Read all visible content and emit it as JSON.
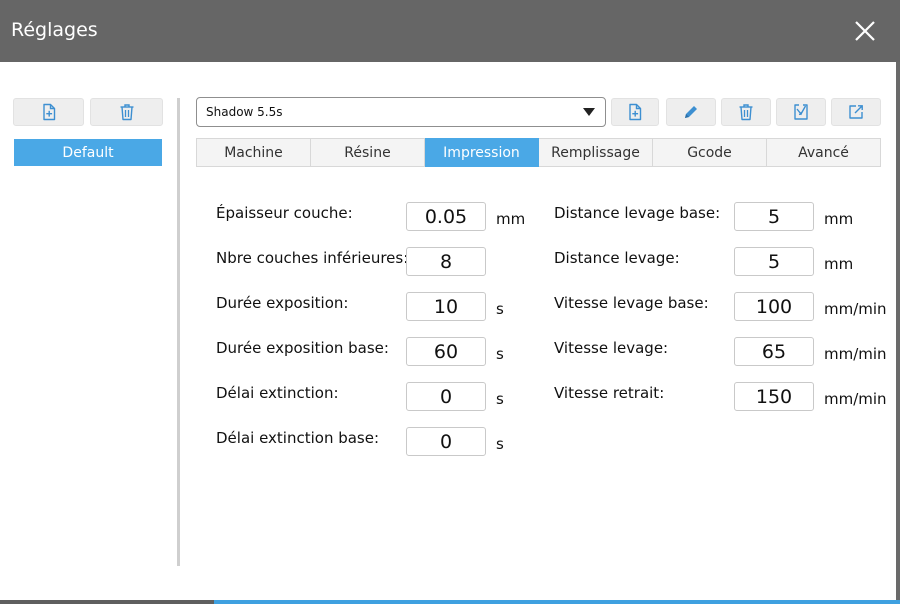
{
  "window": {
    "title": "Réglages"
  },
  "profiles": {
    "items": [
      "Default"
    ]
  },
  "machine_select": {
    "value": "Shadow 5.5s"
  },
  "tabs": [
    {
      "label": "Machine"
    },
    {
      "label": "Résine"
    },
    {
      "label": "Impression",
      "active": true
    },
    {
      "label": "Remplissage"
    },
    {
      "label": "Gcode"
    },
    {
      "label": "Avancé"
    }
  ],
  "left_fields": [
    {
      "label": "Épaisseur couche:",
      "value": "0.05",
      "unit": "mm"
    },
    {
      "label": "Nbre couches inférieures:",
      "value": "8",
      "unit": ""
    },
    {
      "label": "Durée exposition:",
      "value": "10",
      "unit": "s"
    },
    {
      "label": "Durée exposition base:",
      "value": "60",
      "unit": "s"
    },
    {
      "label": "Délai extinction:",
      "value": "0",
      "unit": "s"
    },
    {
      "label": "Délai extinction base:",
      "value": "0",
      "unit": "s"
    }
  ],
  "right_fields": [
    {
      "label": "Distance levage base:",
      "value": "5",
      "unit": "mm"
    },
    {
      "label": "Distance levage:",
      "value": "5",
      "unit": "mm"
    },
    {
      "label": "Vitesse levage base:",
      "value": "100",
      "unit": "mm/min"
    },
    {
      "label": "Vitesse levage:",
      "value": "65",
      "unit": "mm/min"
    },
    {
      "label": "Vitesse retrait:",
      "value": "150",
      "unit": "mm/min"
    }
  ],
  "colors": {
    "titlebar": "#666666",
    "accent": "#4aa8e6",
    "icon": "#3d8fd1"
  },
  "icons": {
    "add_profile": "file-plus-icon",
    "delete_profile": "trash-icon",
    "add_machine": "file-plus-icon",
    "edit_machine": "pencil-icon",
    "delete_machine": "trash-icon",
    "import": "import-icon",
    "export": "export-icon",
    "close": "close-icon"
  }
}
